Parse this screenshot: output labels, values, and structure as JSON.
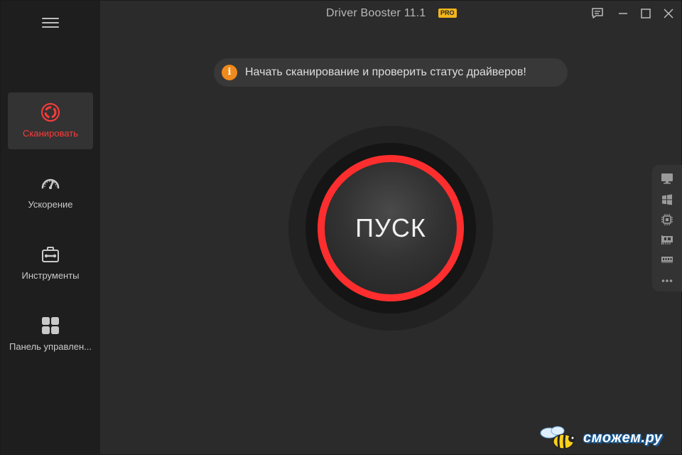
{
  "titlebar": {
    "app_title": "Driver Booster 11.1",
    "badge": "PRO"
  },
  "sidebar": {
    "items": [
      {
        "label": "Сканировать",
        "icon": "scan-icon",
        "active": true
      },
      {
        "label": "Ускорение",
        "icon": "speedometer-icon",
        "active": false
      },
      {
        "label": "Инструменты",
        "icon": "toolbox-icon",
        "active": false
      },
      {
        "label": "Панель управлен...",
        "icon": "control-panel-icon",
        "active": false
      }
    ]
  },
  "banner": {
    "icon_glyph": "i",
    "text": "Начать сканирование и проверить статус драйверов!"
  },
  "scan_button": {
    "label": "ПУСК"
  },
  "quick_panel": {
    "icons": [
      "monitor-icon",
      "windows-icon",
      "cpu-icon",
      "network-card-icon",
      "memory-icon",
      "more-icon"
    ]
  },
  "watermark": {
    "text": "сможем.ру"
  },
  "colors": {
    "accent_red": "#ff2e2e",
    "info_orange": "#f08a1c",
    "badge_gold": "#f2b51c",
    "sidebar_bg": "#1e1e1e",
    "main_bg": "#2b2b2b"
  }
}
